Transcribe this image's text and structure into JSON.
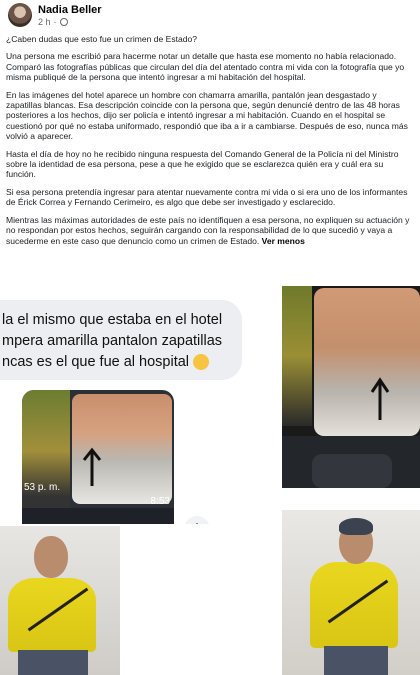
{
  "post": {
    "author": "Nadia Beller",
    "time": "2 h",
    "separator": "·",
    "paragraphs": [
      "¿Caben dudas que esto fue un crimen de Estado?",
      "Una persona me escribió para hacerme notar un detalle que hasta ese momento no había relacionado. Comparó las fotografías públicas que circulan del día del atentado contra mi vida con la fotografía que yo misma publiqué de la persona que intentó ingresar a mi habitación del hospital.",
      "En las imágenes del hotel aparece un hombre con chamarra amarilla, pantalón jean desgastado y zapatillas blancas. Esa descripción coincide con la persona que, según denuncié dentro de las 48 horas posteriores a los hechos, dijo ser policía e intentó ingresar a mi habitación. Cuando en el hospital se cuestionó por qué no estaba uniformado, respondió que iba a ir a cambiarse. Después de eso, nunca más volvió a aparecer.",
      "Hasta el día de hoy no he recibido ninguna respuesta del Comando General de la Policía ni del Ministro sobre la identidad de esa persona, pese a que he exigido que se esclarezca quién era y cuál era su función.",
      "Si esa persona pretendía ingresar para atentar nuevamente contra mi vida o si era uno de los informantes de Érick Correa y Fernando Cerimeiro, es algo que debe ser investigado y esclarecido."
    ],
    "last_paragraph": "Mientras las máximas autoridades de este país no identifiquen a esa persona, no expliquen su actuación y no respondan por estos hechos, seguirán cargando con la responsabilidad de lo que sucedió y vaya a sucederme en este caso que denuncio como un crimen de Estado.",
    "see_more": "Ver menos"
  },
  "media": {
    "message_text": "la el mismo que estaba en el hotel\nmpera amarilla pantalon zapatillas\nncas es el que fue al hospital",
    "phone_time_left": "53 p. m.",
    "phone_time_right": "8:53"
  }
}
